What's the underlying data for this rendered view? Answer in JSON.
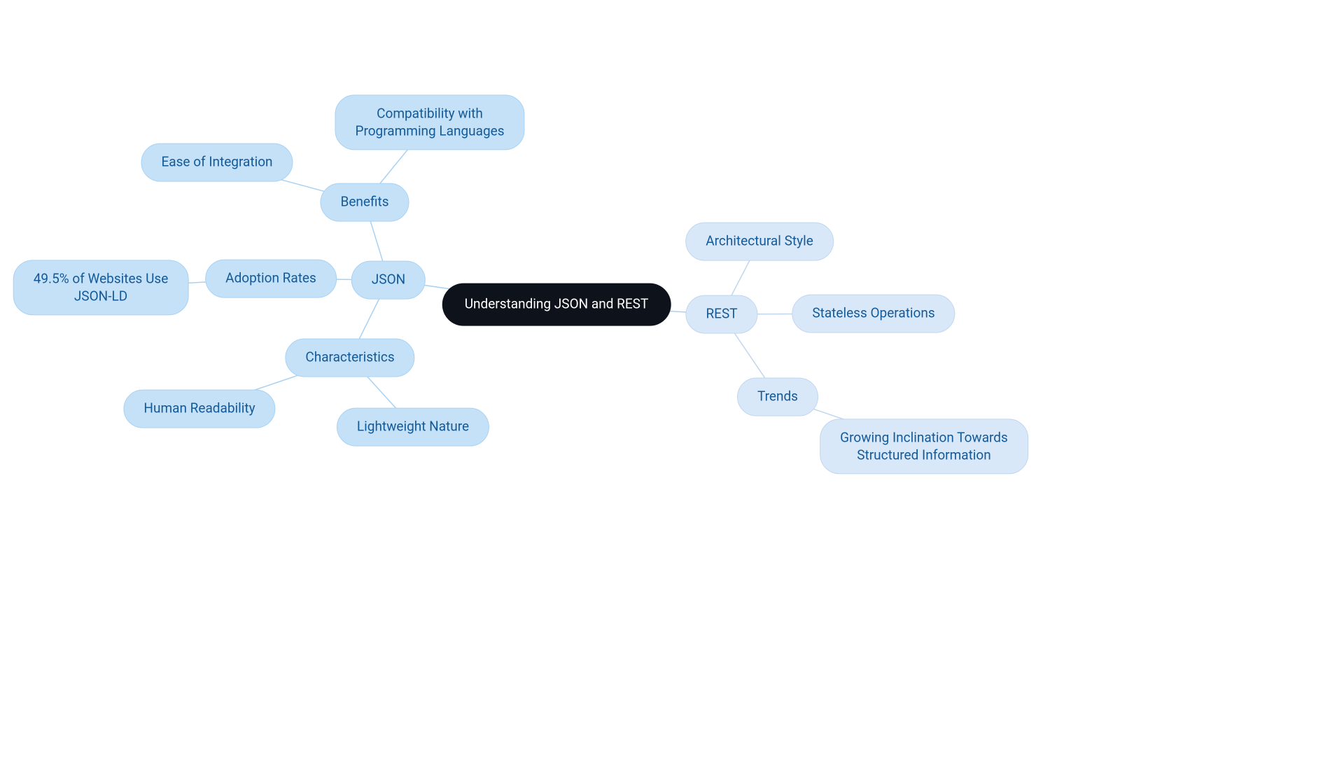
{
  "center": {
    "label": "Understanding JSON and REST"
  },
  "json": {
    "label": "JSON",
    "benefits": {
      "label": "Benefits",
      "ease": "Ease of Integration",
      "compat": "Compatibility with\nProgramming Languages"
    },
    "adoption": {
      "label": "Adoption Rates",
      "stat": "49.5% of Websites Use\nJSON-LD"
    },
    "characteristics": {
      "label": "Characteristics",
      "human": "Human Readability",
      "lightweight": "Lightweight Nature"
    }
  },
  "rest": {
    "label": "REST",
    "arch": "Architectural Style",
    "stateless": "Stateless Operations",
    "trends": {
      "label": "Trends",
      "structured": "Growing Inclination Towards\nStructured Information"
    }
  }
}
